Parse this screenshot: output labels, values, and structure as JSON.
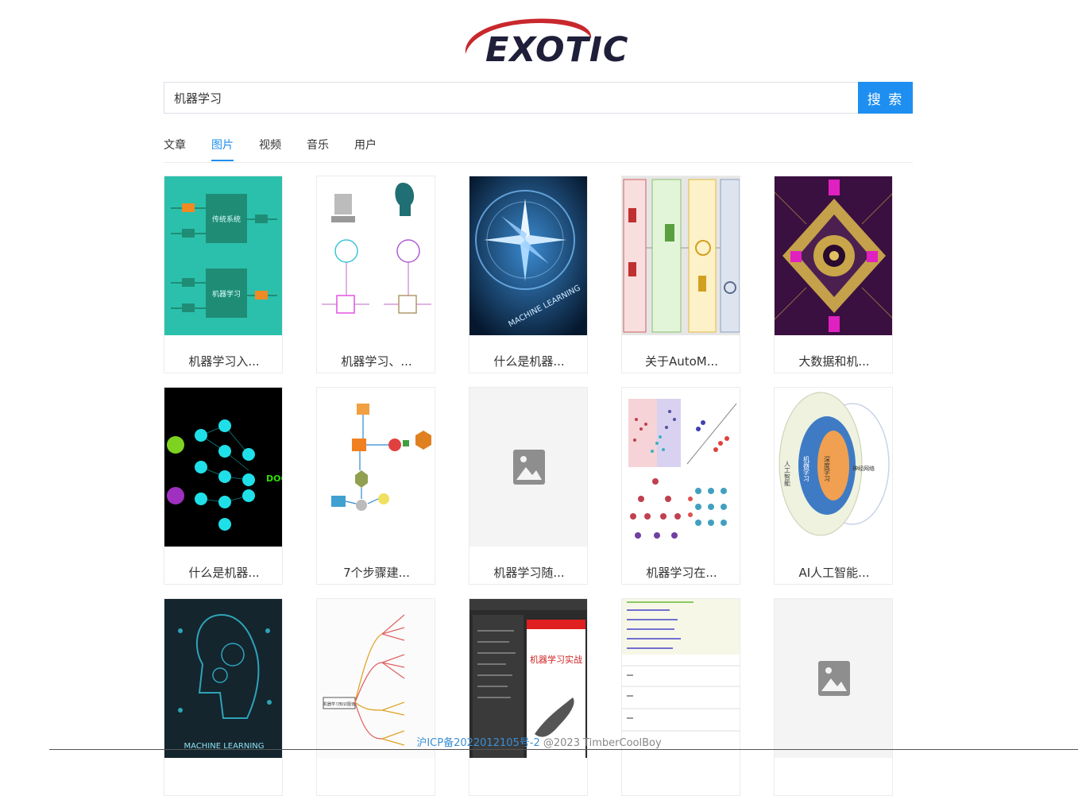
{
  "logo": {
    "text": "EXOTIC",
    "swoosh_color": "#c8282d",
    "text_color": "#1f1f3a"
  },
  "search": {
    "value": "机器学习",
    "button_label": "搜 索",
    "button_color": "#1e8ff0"
  },
  "tabs": [
    {
      "label": "文章",
      "active": false
    },
    {
      "label": "图片",
      "active": true
    },
    {
      "label": "视频",
      "active": false
    },
    {
      "label": "音乐",
      "active": false
    },
    {
      "label": "用户",
      "active": false
    }
  ],
  "results": [
    {
      "caption": "机器学习入...",
      "thumb": "flowchart-teal",
      "labels": [
        "传统系统",
        "机器学习"
      ]
    },
    {
      "caption": "机器学习、...",
      "thumb": "computer-vs-human-diagram"
    },
    {
      "caption": "什么是机器...",
      "thumb": "compass-machine-learning",
      "labels": [
        "MACHINE LEARNING"
      ]
    },
    {
      "caption": "关于AutoM...",
      "thumb": "automl-pipeline"
    },
    {
      "caption": "大数据和机...",
      "thumb": "circuit-chip-purple"
    },
    {
      "caption": "什么是机器...",
      "thumb": "neural-network-dog",
      "labels": [
        "DOG"
      ]
    },
    {
      "caption": "7个步骤建...",
      "thumb": "workflow-steps"
    },
    {
      "caption": "机器学习随...",
      "thumb": "image-placeholder-icon"
    },
    {
      "caption": "机器学习在...",
      "thumb": "ml-model-examples"
    },
    {
      "caption": "AI人工智能...",
      "thumb": "ai-venn-diagram",
      "labels": [
        "人工智能",
        "机器学习",
        "深度学习",
        "神经网络"
      ]
    },
    {
      "caption": "",
      "thumb": "machine-learning-head",
      "labels": [
        "MACHINE LEARNING"
      ]
    },
    {
      "caption": "",
      "thumb": "mindmap-branches",
      "labels": [
        "机器学习知识图谱"
      ]
    },
    {
      "caption": "",
      "thumb": "book-reader-screenshot",
      "labels": [
        "机器学习实战"
      ]
    },
    {
      "caption": "",
      "thumb": "code-screenshot"
    },
    {
      "caption": "",
      "thumb": "image-placeholder-icon"
    }
  ],
  "footer": {
    "icp": "沪ICP备2022012105号-2",
    "copyright": "@2023 TimberCoolBoy"
  }
}
